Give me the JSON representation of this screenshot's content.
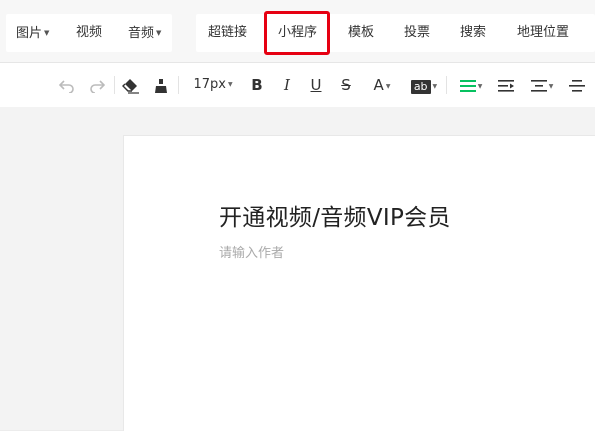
{
  "menu": {
    "items": [
      {
        "label": "图片",
        "dropdown": true
      },
      {
        "label": "视频",
        "dropdown": false
      },
      {
        "label": "音频",
        "dropdown": true
      },
      {
        "label": "超链接",
        "dropdown": false
      },
      {
        "label": "小程序",
        "dropdown": false,
        "highlighted": true
      },
      {
        "label": "模板",
        "dropdown": false
      },
      {
        "label": "投票",
        "dropdown": false
      },
      {
        "label": "搜索",
        "dropdown": false
      },
      {
        "label": "地理位置",
        "dropdown": false
      }
    ],
    "highlight_color": "#e60012"
  },
  "toolbar": {
    "font_size": "17px",
    "bold": "B",
    "italic": "I",
    "underline": "U",
    "strike": "S",
    "font_color": "A",
    "bg_color": "ab",
    "icons": [
      "undo-icon",
      "redo-icon",
      "eraser-icon",
      "format-brush-icon",
      "align-left-icon",
      "indent-icon",
      "line-spacing-icon",
      "align-center-icon"
    ],
    "accent_color": "#07c160"
  },
  "editor": {
    "title": "开通视频/音频VIP会员",
    "author_placeholder": "请输入作者"
  }
}
